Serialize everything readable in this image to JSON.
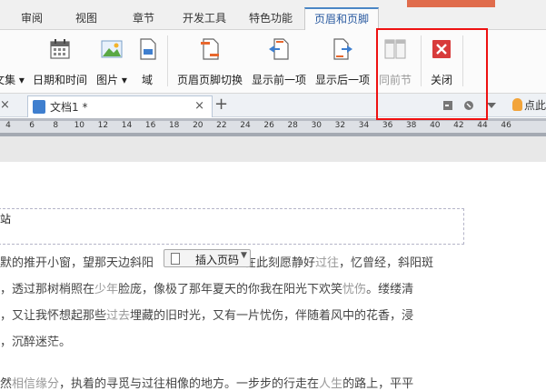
{
  "ribbon_tabs": {
    "review": "审阅",
    "view": "视图",
    "chapter": "章节",
    "dev_tools": "开发工具",
    "special": "特色功能",
    "header_footer": "页眉和页脚"
  },
  "toolbar": {
    "doc_parts": "文集",
    "date_time": "日期和时间",
    "picture": "图片",
    "field": "域",
    "switch_header_footer": "页眉页脚切换",
    "show_prev": "显示前一项",
    "show_next": "显示后一项",
    "same_as_prev": "同前节",
    "close": "关闭"
  },
  "doc_tabs": {
    "active_label": "文档1 *",
    "close_glyph": "×",
    "add_glyph": "+",
    "tip_text": "点此"
  },
  "ruler": {
    "numbers": [
      "4",
      "6",
      "8",
      "10",
      "12",
      "14",
      "16",
      "18",
      "20",
      "22",
      "24",
      "26",
      "28",
      "30",
      "32",
      "34",
      "36",
      "38",
      "40",
      "42",
      "44",
      "46"
    ]
  },
  "document": {
    "header_text": "站",
    "insert_page_number": "插入页码",
    "lines": [
      {
        "parts": [
          [
            "默的推开小窗，望那天边斜阳",
            ""
          ],
          [
            "",
            "gap"
          ],
          [
            "在此刻愿静好",
            ""
          ],
          [
            "过往",
            "hl"
          ],
          [
            "，忆曾经，斜阳斑",
            ""
          ]
        ]
      },
      {
        "parts": [
          [
            "，透过那树梢照在",
            ""
          ],
          [
            "少年",
            "hl"
          ],
          [
            "脸庞，像极了那年夏天的你我在阳光下欢笑",
            ""
          ],
          [
            "忧伤",
            "hl"
          ],
          [
            "。缕缕清",
            ""
          ]
        ]
      },
      {
        "parts": [
          [
            "，又让我怀想起那些",
            ""
          ],
          [
            "过去",
            "hl"
          ],
          [
            "埋藏的旧时光，又有一片忧伤，伴随着风中的花香，浸",
            ""
          ]
        ]
      },
      {
        "parts": [
          [
            "，沉醉迷茫。",
            ""
          ]
        ]
      },
      {
        "parts": [
          [
            "然",
            ""
          ],
          [
            "相信缘分",
            "hl"
          ],
          [
            "，执着的寻觅与过往相像的地方。一步步的行走在",
            ""
          ],
          [
            "人生",
            "hl"
          ],
          [
            "的路上，平平",
            ""
          ]
        ]
      }
    ]
  },
  "colors": {
    "active_tab": "#2a5aa0",
    "highlight_box": "#ee1111",
    "close_red": "#d83b3b"
  }
}
